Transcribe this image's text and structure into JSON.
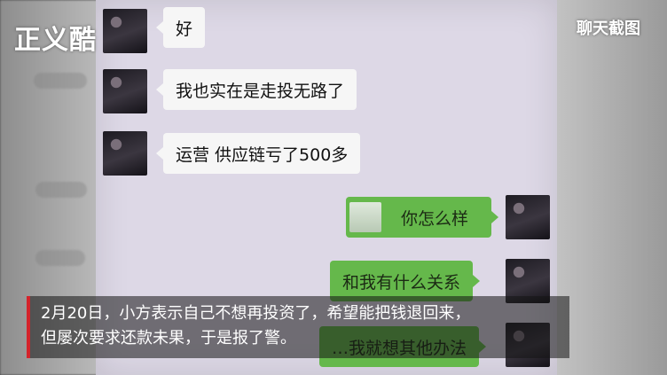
{
  "watermark": {
    "logo": "正义酷",
    "label": "聊天截图"
  },
  "messages": [
    {
      "side": "in",
      "text": "好"
    },
    {
      "side": "in",
      "text": "我也实在是走投无路了"
    },
    {
      "side": "in",
      "text": "运营 供应链亏了500多"
    },
    {
      "side": "out",
      "text": "你怎么样"
    },
    {
      "side": "out",
      "text": "和我有什么关系"
    },
    {
      "side": "out",
      "text": "…我就想其他办法"
    }
  ],
  "caption": {
    "line1": "2月20日，小方表示自己不想再投资了，希望能把钱退回来，",
    "line2": "但屡次要求还款未果，于是报了警。"
  }
}
